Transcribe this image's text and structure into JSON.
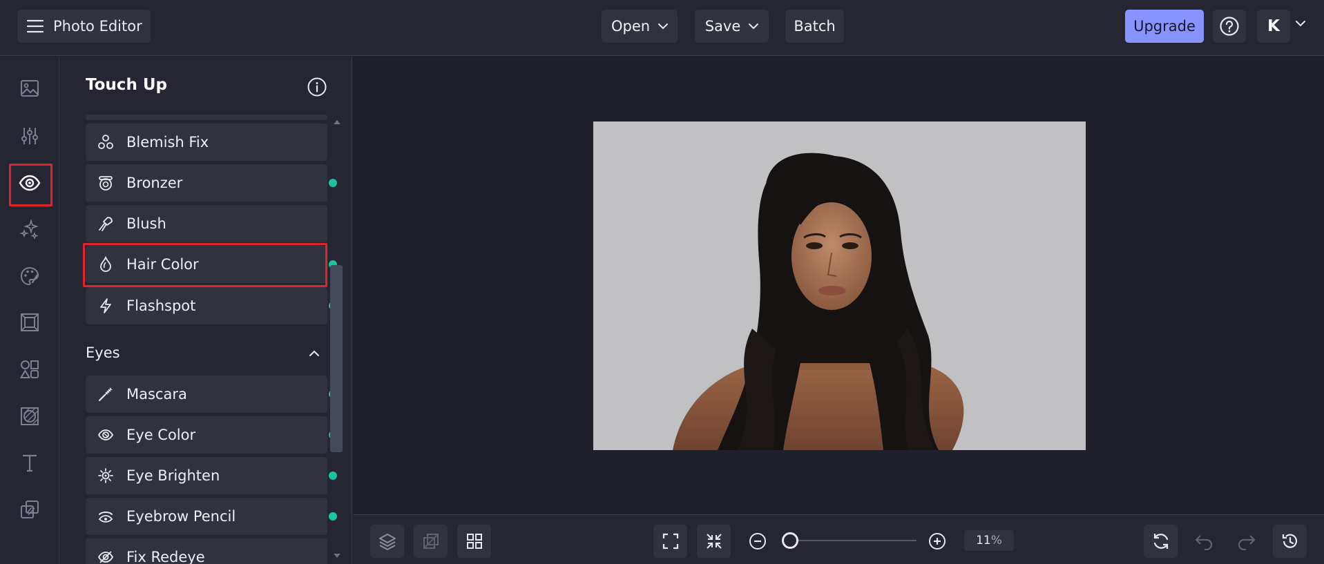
{
  "app": {
    "title": "Photo Editor"
  },
  "toolbar": {
    "open": "Open",
    "save": "Save",
    "batch": "Batch",
    "upgrade": "Upgrade",
    "avatar_initial": "K"
  },
  "rail": {
    "items": [
      {
        "icon": "image-icon"
      },
      {
        "icon": "sliders-icon"
      },
      {
        "icon": "eye-icon",
        "active": true
      },
      {
        "icon": "sparkles-icon"
      },
      {
        "icon": "palette-icon"
      },
      {
        "icon": "frame-icon"
      },
      {
        "icon": "shapes-icon"
      },
      {
        "icon": "texture-icon"
      },
      {
        "icon": "text-icon"
      },
      {
        "icon": "graphics-icon"
      }
    ]
  },
  "panel": {
    "title": "Touch Up",
    "items": [
      {
        "label": "Blemish Fix",
        "icon": "blemish-icon",
        "premium": false
      },
      {
        "label": "Bronzer",
        "icon": "bronzer-icon",
        "premium": true
      },
      {
        "label": "Blush",
        "icon": "brush-icon",
        "premium": false
      },
      {
        "label": "Hair Color",
        "icon": "droplet-icon",
        "premium": true,
        "highlighted": true
      },
      {
        "label": "Flashspot",
        "icon": "lightning-icon",
        "premium": true
      }
    ],
    "eyes_section": {
      "title": "Eyes",
      "items": [
        {
          "label": "Mascara",
          "icon": "mascara-icon",
          "premium": true
        },
        {
          "label": "Eye Color",
          "icon": "eye-color-icon",
          "premium": true
        },
        {
          "label": "Eye Brighten",
          "icon": "sun-icon",
          "premium": true
        },
        {
          "label": "Eyebrow Pencil",
          "icon": "eyebrow-icon",
          "premium": true
        },
        {
          "label": "Fix Redeye",
          "icon": "redeye-icon",
          "premium": false
        }
      ]
    }
  },
  "bottom": {
    "zoom_value": "11",
    "zoom_unit": "%",
    "zoom_fraction": 0.0
  },
  "colors": {
    "accent": "#8793ff",
    "premium_dot": "#19c4a0",
    "highlight": "#e0242a",
    "bg": "#1f2029",
    "panel": "#252631"
  }
}
